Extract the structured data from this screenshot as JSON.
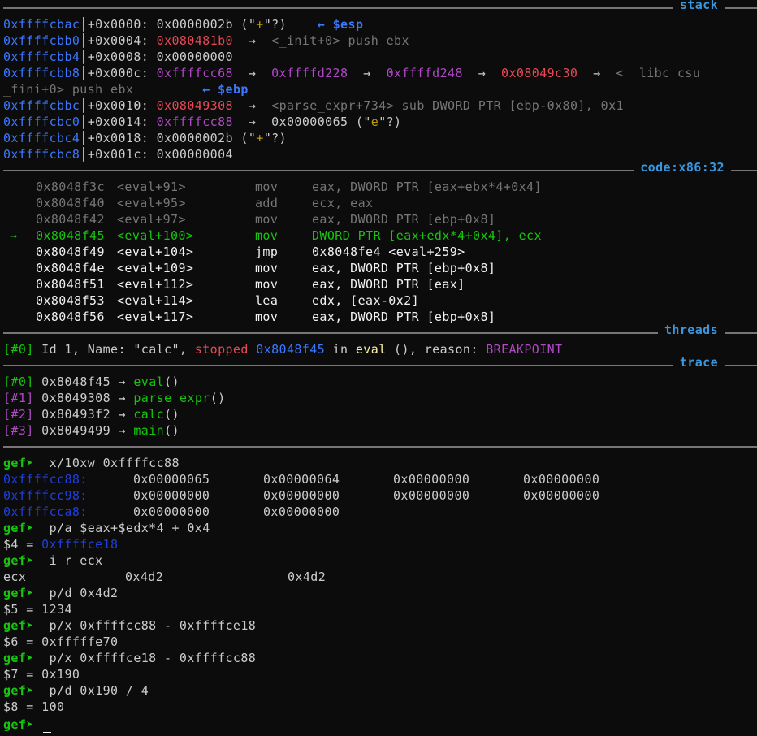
{
  "headers": {
    "stack": "stack",
    "code": "code:x86:32",
    "threads": "threads",
    "trace": "trace"
  },
  "stack": [
    {
      "addr": "0xffffcbac",
      "off": "+0x0000:",
      "val": "0x0000002b",
      "rest": " (\"",
      "ch": "+",
      "rest2": "\"?)",
      "reg": "← $esp"
    },
    {
      "addr": "0xffffcbb0",
      "off": "+0x0004:",
      "val": "0x080481b0",
      "arrow": "→",
      "sym": "<_init+0> push ebx"
    },
    {
      "addr": "0xffffcbb4",
      "off": "+0x0008:",
      "val": "0x00000000"
    },
    {
      "addr": "0xffffcbb8",
      "off": "+0x000c:",
      "chain": [
        "0xffffcc68",
        "0xffffd228",
        "0xffffd248",
        "0x08049c30"
      ],
      "sym": "<__libc_csu",
      "wrap": "_fini+0> push ebx",
      "reg": "← $ebp"
    },
    {
      "addr": "0xffffcbbc",
      "off": "+0x0010:",
      "val": "0x08049308",
      "arrow": "→",
      "sym": "<parse_expr+734> sub DWORD PTR [ebp-0x80], 0x1"
    },
    {
      "addr": "0xffffcbc0",
      "off": "+0x0014:",
      "val": "0xffffcc88",
      "arrow": "→",
      "val2": "0x00000065",
      "rest": " (\"",
      "ch": "e",
      "rest2": "\"?)"
    },
    {
      "addr": "0xffffcbc4",
      "off": "+0x0018:",
      "val": "0x0000002b",
      "rest": " (\"",
      "ch": "+",
      "rest2": "\"?)"
    },
    {
      "addr": "0xffffcbc8",
      "off": "+0x001c:",
      "val": "0x00000004"
    }
  ],
  "code": [
    {
      "marker": "",
      "addr": "0x8048f3c",
      "sym": "<eval+91>",
      "mn": "mov",
      "ops": "eax, DWORD PTR [eax+ebx*4+0x4]",
      "state": "past"
    },
    {
      "marker": "",
      "addr": "0x8048f40",
      "sym": "<eval+95>",
      "mn": "add",
      "ops": "ecx, eax",
      "state": "past"
    },
    {
      "marker": "",
      "addr": "0x8048f42",
      "sym": "<eval+97>",
      "mn": "mov",
      "ops": "eax, DWORD PTR [ebp+0x8]",
      "state": "past"
    },
    {
      "marker": "→",
      "addr": "0x8048f45",
      "sym": "<eval+100>",
      "mn": "mov",
      "ops": "DWORD PTR [eax+edx*4+0x4], ecx",
      "state": "cur"
    },
    {
      "marker": "",
      "addr": "0x8048f49",
      "sym": "<eval+104>",
      "mn": "jmp",
      "ops": "0x8048fe4 <eval+259>",
      "state": "next"
    },
    {
      "marker": "",
      "addr": "0x8048f4e",
      "sym": "<eval+109>",
      "mn": "mov",
      "ops": "eax, DWORD PTR [ebp+0x8]",
      "state": "next"
    },
    {
      "marker": "",
      "addr": "0x8048f51",
      "sym": "<eval+112>",
      "mn": "mov",
      "ops": "eax, DWORD PTR [eax]",
      "state": "next"
    },
    {
      "marker": "",
      "addr": "0x8048f53",
      "sym": "<eval+114>",
      "mn": "lea",
      "ops": "edx, [eax-0x2]",
      "state": "next"
    },
    {
      "marker": "",
      "addr": "0x8048f56",
      "sym": "<eval+117>",
      "mn": "mov",
      "ops": "eax, DWORD PTR [ebp+0x8]",
      "state": "next"
    }
  ],
  "thread": {
    "idx": "[#0]",
    "p1": " Id 1, Name: \"calc\", ",
    "stopped": "stopped",
    "addr": "0x8048f45",
    "p2": " in ",
    "func": "eval",
    "p3": " (), reason: ",
    "reason": "BREAKPOINT"
  },
  "trace": [
    {
      "idx": "[#0]",
      "addr": "0x8048f45",
      "arrow": "→",
      "func": "eval",
      "paren": "()"
    },
    {
      "idx": "[#1]",
      "addr": "0x8049308",
      "arrow": "→",
      "func": "parse_expr",
      "paren": "()"
    },
    {
      "idx": "[#2]",
      "addr": "0x80493f2",
      "arrow": "→",
      "func": "calc",
      "paren": "()"
    },
    {
      "idx": "[#3]",
      "addr": "0x8049499",
      "arrow": "→",
      "func": "main",
      "paren": "()"
    }
  ],
  "console": {
    "prompt": "gef➤ ",
    "cmd1": " x/10xw 0xffffcc88",
    "mem": [
      {
        "addr": "0xffffcc88:",
        "vals": [
          "0x00000065",
          "0x00000064",
          "0x00000000",
          "0x00000000"
        ]
      },
      {
        "addr": "0xffffcc98:",
        "vals": [
          "0x00000000",
          "0x00000000",
          "0x00000000",
          "0x00000000"
        ]
      },
      {
        "addr": "0xffffcca8:",
        "vals": [
          "0x00000000",
          "0x00000000"
        ]
      }
    ],
    "cmd2": " p/a $eax+$edx*4 + 0x4",
    "res2_label": "$4 = ",
    "res2_val": "0xffffce18",
    "cmd3": " i r ecx",
    "reg_name": "ecx",
    "reg_hex": "0x4d2",
    "reg_nat": "0x4d2",
    "cmd4": " p/d 0x4d2",
    "res4": "$5 = 1234",
    "cmd5": " p/x 0xffffcc88 - 0xffffce18",
    "res5": "$6 = 0xfffffe70",
    "cmd6": " p/x 0xffffce18 - 0xffffcc88",
    "res6": "$7 = 0x190",
    "cmd7": " p/d 0x190 / 4",
    "res7": "$8 = 100"
  }
}
